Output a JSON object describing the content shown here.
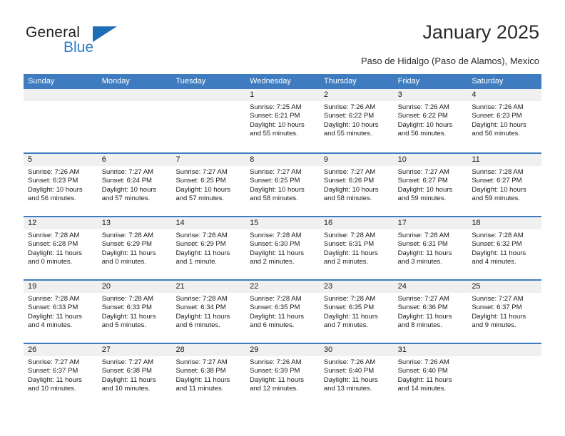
{
  "brand": {
    "name_part1": "General",
    "name_part2": "Blue",
    "flag_icon": "flag-icon"
  },
  "header": {
    "title": "January 2025",
    "subtitle": "Paso de Hidalgo (Paso de Alamos), Mexico"
  },
  "colors": {
    "header_blue": "#3f7cbf",
    "brand_blue": "#2b7cc4",
    "flag_blue": "#1f6db5",
    "day_band_gray": "#f0f0f0",
    "text_dark": "#1a1a1a"
  },
  "weekdays": [
    "Sunday",
    "Monday",
    "Tuesday",
    "Wednesday",
    "Thursday",
    "Friday",
    "Saturday"
  ],
  "weeks": [
    [
      {
        "day": "",
        "empty": true,
        "sunrise": "",
        "sunset": "",
        "daylight_line1": "",
        "daylight_line2": ""
      },
      {
        "day": "",
        "empty": true,
        "sunrise": "",
        "sunset": "",
        "daylight_line1": "",
        "daylight_line2": ""
      },
      {
        "day": "",
        "empty": true,
        "sunrise": "",
        "sunset": "",
        "daylight_line1": "",
        "daylight_line2": ""
      },
      {
        "day": "1",
        "empty": false,
        "sunrise": "Sunrise: 7:25 AM",
        "sunset": "Sunset: 6:21 PM",
        "daylight_line1": "Daylight: 10 hours",
        "daylight_line2": "and 55 minutes."
      },
      {
        "day": "2",
        "empty": false,
        "sunrise": "Sunrise: 7:26 AM",
        "sunset": "Sunset: 6:22 PM",
        "daylight_line1": "Daylight: 10 hours",
        "daylight_line2": "and 55 minutes."
      },
      {
        "day": "3",
        "empty": false,
        "sunrise": "Sunrise: 7:26 AM",
        "sunset": "Sunset: 6:22 PM",
        "daylight_line1": "Daylight: 10 hours",
        "daylight_line2": "and 56 minutes."
      },
      {
        "day": "4",
        "empty": false,
        "sunrise": "Sunrise: 7:26 AM",
        "sunset": "Sunset: 6:23 PM",
        "daylight_line1": "Daylight: 10 hours",
        "daylight_line2": "and 56 minutes."
      }
    ],
    [
      {
        "day": "5",
        "empty": false,
        "sunrise": "Sunrise: 7:26 AM",
        "sunset": "Sunset: 6:23 PM",
        "daylight_line1": "Daylight: 10 hours",
        "daylight_line2": "and 56 minutes."
      },
      {
        "day": "6",
        "empty": false,
        "sunrise": "Sunrise: 7:27 AM",
        "sunset": "Sunset: 6:24 PM",
        "daylight_line1": "Daylight: 10 hours",
        "daylight_line2": "and 57 minutes."
      },
      {
        "day": "7",
        "empty": false,
        "sunrise": "Sunrise: 7:27 AM",
        "sunset": "Sunset: 6:25 PM",
        "daylight_line1": "Daylight: 10 hours",
        "daylight_line2": "and 57 minutes."
      },
      {
        "day": "8",
        "empty": false,
        "sunrise": "Sunrise: 7:27 AM",
        "sunset": "Sunset: 6:25 PM",
        "daylight_line1": "Daylight: 10 hours",
        "daylight_line2": "and 58 minutes."
      },
      {
        "day": "9",
        "empty": false,
        "sunrise": "Sunrise: 7:27 AM",
        "sunset": "Sunset: 6:26 PM",
        "daylight_line1": "Daylight: 10 hours",
        "daylight_line2": "and 58 minutes."
      },
      {
        "day": "10",
        "empty": false,
        "sunrise": "Sunrise: 7:27 AM",
        "sunset": "Sunset: 6:27 PM",
        "daylight_line1": "Daylight: 10 hours",
        "daylight_line2": "and 59 minutes."
      },
      {
        "day": "11",
        "empty": false,
        "sunrise": "Sunrise: 7:28 AM",
        "sunset": "Sunset: 6:27 PM",
        "daylight_line1": "Daylight: 10 hours",
        "daylight_line2": "and 59 minutes."
      }
    ],
    [
      {
        "day": "12",
        "empty": false,
        "sunrise": "Sunrise: 7:28 AM",
        "sunset": "Sunset: 6:28 PM",
        "daylight_line1": "Daylight: 11 hours",
        "daylight_line2": "and 0 minutes."
      },
      {
        "day": "13",
        "empty": false,
        "sunrise": "Sunrise: 7:28 AM",
        "sunset": "Sunset: 6:29 PM",
        "daylight_line1": "Daylight: 11 hours",
        "daylight_line2": "and 0 minutes."
      },
      {
        "day": "14",
        "empty": false,
        "sunrise": "Sunrise: 7:28 AM",
        "sunset": "Sunset: 6:29 PM",
        "daylight_line1": "Daylight: 11 hours",
        "daylight_line2": "and 1 minute."
      },
      {
        "day": "15",
        "empty": false,
        "sunrise": "Sunrise: 7:28 AM",
        "sunset": "Sunset: 6:30 PM",
        "daylight_line1": "Daylight: 11 hours",
        "daylight_line2": "and 2 minutes."
      },
      {
        "day": "16",
        "empty": false,
        "sunrise": "Sunrise: 7:28 AM",
        "sunset": "Sunset: 6:31 PM",
        "daylight_line1": "Daylight: 11 hours",
        "daylight_line2": "and 2 minutes."
      },
      {
        "day": "17",
        "empty": false,
        "sunrise": "Sunrise: 7:28 AM",
        "sunset": "Sunset: 6:31 PM",
        "daylight_line1": "Daylight: 11 hours",
        "daylight_line2": "and 3 minutes."
      },
      {
        "day": "18",
        "empty": false,
        "sunrise": "Sunrise: 7:28 AM",
        "sunset": "Sunset: 6:32 PM",
        "daylight_line1": "Daylight: 11 hours",
        "daylight_line2": "and 4 minutes."
      }
    ],
    [
      {
        "day": "19",
        "empty": false,
        "sunrise": "Sunrise: 7:28 AM",
        "sunset": "Sunset: 6:33 PM",
        "daylight_line1": "Daylight: 11 hours",
        "daylight_line2": "and 4 minutes."
      },
      {
        "day": "20",
        "empty": false,
        "sunrise": "Sunrise: 7:28 AM",
        "sunset": "Sunset: 6:33 PM",
        "daylight_line1": "Daylight: 11 hours",
        "daylight_line2": "and 5 minutes."
      },
      {
        "day": "21",
        "empty": false,
        "sunrise": "Sunrise: 7:28 AM",
        "sunset": "Sunset: 6:34 PM",
        "daylight_line1": "Daylight: 11 hours",
        "daylight_line2": "and 6 minutes."
      },
      {
        "day": "22",
        "empty": false,
        "sunrise": "Sunrise: 7:28 AM",
        "sunset": "Sunset: 6:35 PM",
        "daylight_line1": "Daylight: 11 hours",
        "daylight_line2": "and 6 minutes."
      },
      {
        "day": "23",
        "empty": false,
        "sunrise": "Sunrise: 7:28 AM",
        "sunset": "Sunset: 6:35 PM",
        "daylight_line1": "Daylight: 11 hours",
        "daylight_line2": "and 7 minutes."
      },
      {
        "day": "24",
        "empty": false,
        "sunrise": "Sunrise: 7:27 AM",
        "sunset": "Sunset: 6:36 PM",
        "daylight_line1": "Daylight: 11 hours",
        "daylight_line2": "and 8 minutes."
      },
      {
        "day": "25",
        "empty": false,
        "sunrise": "Sunrise: 7:27 AM",
        "sunset": "Sunset: 6:37 PM",
        "daylight_line1": "Daylight: 11 hours",
        "daylight_line2": "and 9 minutes."
      }
    ],
    [
      {
        "day": "26",
        "empty": false,
        "sunrise": "Sunrise: 7:27 AM",
        "sunset": "Sunset: 6:37 PM",
        "daylight_line1": "Daylight: 11 hours",
        "daylight_line2": "and 10 minutes."
      },
      {
        "day": "27",
        "empty": false,
        "sunrise": "Sunrise: 7:27 AM",
        "sunset": "Sunset: 6:38 PM",
        "daylight_line1": "Daylight: 11 hours",
        "daylight_line2": "and 10 minutes."
      },
      {
        "day": "28",
        "empty": false,
        "sunrise": "Sunrise: 7:27 AM",
        "sunset": "Sunset: 6:38 PM",
        "daylight_line1": "Daylight: 11 hours",
        "daylight_line2": "and 11 minutes."
      },
      {
        "day": "29",
        "empty": false,
        "sunrise": "Sunrise: 7:26 AM",
        "sunset": "Sunset: 6:39 PM",
        "daylight_line1": "Daylight: 11 hours",
        "daylight_line2": "and 12 minutes."
      },
      {
        "day": "30",
        "empty": false,
        "sunrise": "Sunrise: 7:26 AM",
        "sunset": "Sunset: 6:40 PM",
        "daylight_line1": "Daylight: 11 hours",
        "daylight_line2": "and 13 minutes."
      },
      {
        "day": "31",
        "empty": false,
        "sunrise": "Sunrise: 7:26 AM",
        "sunset": "Sunset: 6:40 PM",
        "daylight_line1": "Daylight: 11 hours",
        "daylight_line2": "and 14 minutes."
      },
      {
        "day": "",
        "empty": true,
        "sunrise": "",
        "sunset": "",
        "daylight_line1": "",
        "daylight_line2": ""
      }
    ]
  ]
}
